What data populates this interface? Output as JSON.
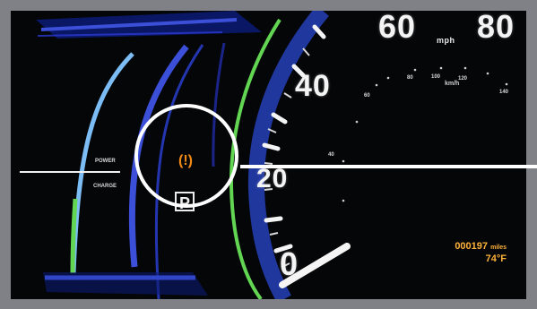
{
  "cluster": {
    "speedometer": {
      "mph_ticks": [
        "0",
        "20",
        "40",
        "60",
        "80"
      ],
      "unit_mph": "mph",
      "unit_kmh": "km/h",
      "kmh_ticks": [
        "40",
        "60",
        "80",
        "100",
        "120",
        "140"
      ]
    },
    "power_gauge": {
      "top_label": "POWER",
      "bottom_label": "CHARGE"
    },
    "indicators": {
      "tpms_icon": "(!)",
      "park_icon": "P"
    },
    "odometer": {
      "value": "000197",
      "unit": "miles",
      "temperature": "74°F"
    }
  },
  "colors": {
    "bezel": "#7f8186",
    "display_bg": "#050608",
    "tpms_warning": "#f08a17",
    "odometer_amber": "#ffb23a",
    "power_green": "#62d653",
    "accent_blue": "#3b4fd8"
  }
}
